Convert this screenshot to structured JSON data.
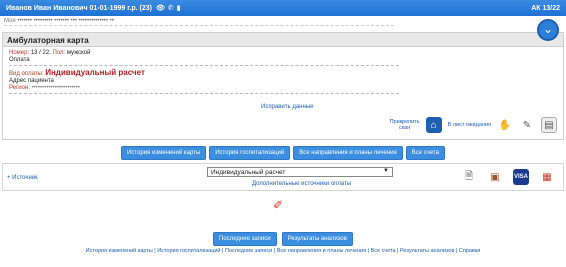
{
  "header": {
    "patient": "Иванов Иван Иванович 01-01-1999 г.р. (23)",
    "ak": "АК 13/22",
    "icons": [
      "eye-icon",
      "phone-icon",
      "clipboard-icon"
    ]
  },
  "subline": "Моя ••••••• ••••••••• ••••••• ••• •••••••••••••• ••",
  "card": {
    "title": "Амбулаторная карта",
    "number_label": "Номер:",
    "number_value": "13 / 22.",
    "sex_label": "Пол:",
    "sex_value": "мужской",
    "payment_section": "Оплата",
    "payment_type_label": "Вид оплаты:",
    "payment_type_value": "Индивидуальный расчет",
    "address_label": "Адрес пациента",
    "region_label": "Регион:",
    "region_value": "•••••••••••••••••••••••",
    "edit_link": "Исправить данные",
    "hide_scan": "Прикрепить\nскан",
    "waiting_list": "В лист ожидания"
  },
  "buttons": [
    "История изменений карты",
    "История госпитализаций",
    "Все направления и планы лечения",
    "Все счета"
  ],
  "payment": {
    "source_link": "+ Источник",
    "selected": "Индивидуальный расчет",
    "extra_link": "Дополнительные источники оплаты"
  },
  "bottom_buttons": [
    "Последние записи",
    "Результаты анализов"
  ],
  "footer": "История изменений карты | История госпитализаций | Последние записи | Все направления и планы лечения | Все счета | Результаты анализов | Справки"
}
